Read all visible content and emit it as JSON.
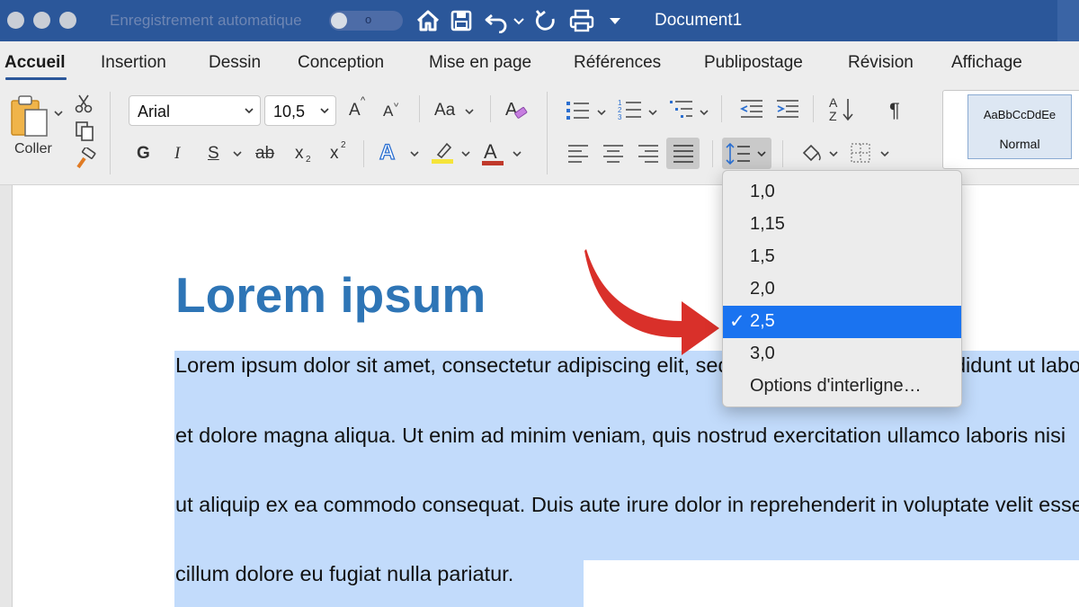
{
  "window": {
    "autosave_label": "Enregistrement automatique",
    "autosave_toggle_text": "o",
    "document_title": "Document1"
  },
  "tabs": [
    {
      "label": "Accueil",
      "active": true
    },
    {
      "label": "Insertion"
    },
    {
      "label": "Dessin"
    },
    {
      "label": "Conception"
    },
    {
      "label": "Mise en page"
    },
    {
      "label": "Références"
    },
    {
      "label": "Publipostage"
    },
    {
      "label": "Révision"
    },
    {
      "label": "Affichage"
    }
  ],
  "ribbon": {
    "paste_label": "Coller",
    "font_name": "Arial",
    "font_size": "10,5",
    "grow_font": "A",
    "shrink_font": "A",
    "change_case": "Aa",
    "bold": "G",
    "italic": "I",
    "underline": "S",
    "strikethrough": "ab",
    "subscript": "x",
    "subscript_mark": "2",
    "superscript": "x",
    "superscript_mark": "2",
    "text_effects": "A",
    "font_color": "A",
    "pilcrow": "¶",
    "sort_az": "A",
    "sort_z": "Z",
    "style_sample": "AaBbCcDdEe",
    "style_name": "Normal"
  },
  "colors": {
    "title_bar": "#2b579a",
    "heading": "#2e75b6",
    "selection": "#c2dbfb",
    "menu_selected": "#1a73f0",
    "annotation_arrow": "#d9302a",
    "highlighter_yellow": "#f5e43a",
    "font_color_red": "#c0392b"
  },
  "document": {
    "heading": "Lorem ipsum",
    "lines": [
      "Lorem ipsum dolor sit amet, consectetur adipiscing elit, sed do eiusmod tempor incididunt ut labore",
      "et dolore magna aliqua. Ut enim ad minim veniam, quis nostrud exercitation ullamco laboris nisi",
      "ut aliquip ex ea commodo consequat. Duis aute irure dolor in reprehenderit in voluptate velit esse",
      "cillum dolore eu fugiat nulla pariatur."
    ]
  },
  "line_spacing_menu": {
    "items": [
      {
        "label": "1,0"
      },
      {
        "label": "1,15"
      },
      {
        "label": "1,5"
      },
      {
        "label": "2,0"
      },
      {
        "label": "2,5",
        "selected": true
      },
      {
        "label": "3,0"
      },
      {
        "label": "Options d'interligne…"
      }
    ],
    "check_glyph": "✓"
  }
}
